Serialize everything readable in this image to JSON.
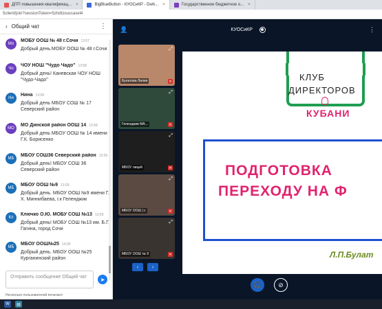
{
  "browser": {
    "tabs": [
      {
        "label": "ДПП повышения квалификац...",
        "color": "#e55353"
      },
      {
        "label": "BigBlueButton - КУОСиКР - Dwh...",
        "color": "#3e6ad6",
        "active": true
      },
      {
        "label": "Государственное бюджетное о...",
        "color": "#7d3fbd"
      }
    ],
    "address": "5client/join?sessionToken=5zhdtzouccasel4"
  },
  "chat": {
    "title": "Общий чат",
    "messages": [
      {
        "initials": "Мо",
        "color": "#6a3fbf",
        "name": "МОБУ ООШ № 48 г.Сочи",
        "time": "13:57",
        "text": "Добрый день.МОБУ ООШ № 48 г.Сочи"
      },
      {
        "initials": "Чо",
        "color": "#6a3fbf",
        "name": "ЧОУ НОШ \"Чудо Чадо\"",
        "time": "13:58",
        "text": "Добрый день! Каневская ЧОУ НОШ \"Чудо-Чадо\""
      },
      {
        "initials": "Ни",
        "color": "#1c6fb8",
        "name": "Нина",
        "time": "13:58",
        "text": "Добрый день МБОУ СОШ № 17 Северский район"
      },
      {
        "initials": "МО",
        "color": "#6a3fbf",
        "name": "МО Динской район ООШ 14",
        "time": "13:58",
        "text": "Добрый день МБОУ ООШ № 14 имени Г.К. Борисенко"
      },
      {
        "initials": "МБ",
        "color": "#1c6fb8",
        "name": "МБОУ СОШ36 Северский район",
        "time": "13:59",
        "text": "Добрый день! МБОУ СОШ 36 Северский район"
      },
      {
        "initials": "МБ",
        "color": "#1c6fb8",
        "name": "МБОУ ООШ №9",
        "time": "13:59",
        "text": "Добрый день. МБОУ ООШ №9 имени Г. Х. Миннибаева, г.к Геленджик"
      },
      {
        "initials": "Кл",
        "color": "#1c6fb8",
        "name": "Ключко О.Ю. МОБУ СОШ №13",
        "time": "13:59",
        "text": "Добрый день! МОБУ СОШ №13 им. Б.Г. Гагина, город Сочи"
      },
      {
        "initials": "МБ",
        "color": "#1c6fb8",
        "name": "МБОУ ООШ№25",
        "time": "14:00",
        "text": "Добрый день. МБОУ ООШ №25 Курганинский район"
      }
    ],
    "placeholder": "Отправить сообщение Общий чат",
    "typing": "Несколько пользователей печатают"
  },
  "meeting": {
    "room": "КУОСиКР",
    "videos": [
      {
        "label": "Булатова Лилия",
        "bg": "#b9876a"
      },
      {
        "label": "Геленджик МА...",
        "bg": "#2f4a3a"
      },
      {
        "label": "МБОУ лицей",
        "bg": "#1e1e1e"
      },
      {
        "label": "МБОУ ООШ | с",
        "bg": "#5b4a42"
      },
      {
        "label": "МБОУ ООШ № 9",
        "bg": "#3a3430"
      }
    ],
    "prev": "‹",
    "next": "›"
  },
  "slide": {
    "logo_line1": "КЛУБ",
    "logo_line2": "ДИРЕКТОРОВ",
    "logo_line3": "КУБАНИ",
    "title_line1": "ПОДГОТОВКА",
    "title_line2": "ПЕРЕХОДУ НА Ф",
    "author": "Л.П.Булат"
  }
}
